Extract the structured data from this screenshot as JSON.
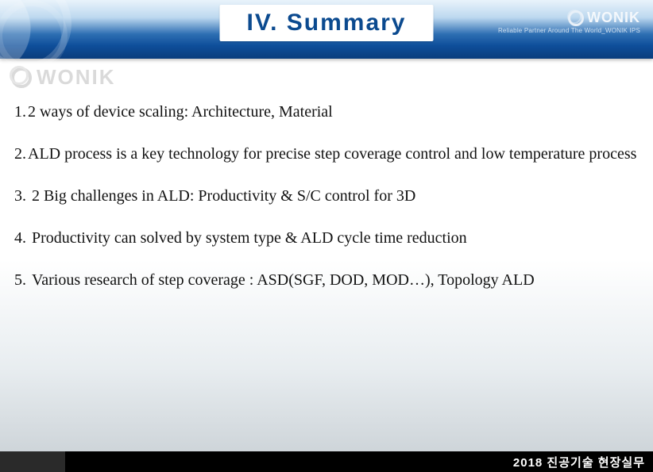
{
  "header": {
    "title": "IV.  Summary",
    "brand_name": "WONIK",
    "brand_tagline": "Reliable Partner Around The World_WONIK IPS"
  },
  "watermark": {
    "brand_name": "WONIK"
  },
  "summary": {
    "items": [
      {
        "num": "1.",
        "text": "2 ways of device scaling: Architecture, Material",
        "pad": ""
      },
      {
        "num": "2.",
        "text": "ALD process is a key technology for precise step coverage control and low temperature process",
        "pad": ""
      },
      {
        "num": "3.",
        "text": "2 Big challenges in ALD: Productivity & S/C control for 3D",
        "pad": " "
      },
      {
        "num": "4.",
        "text": "Productivity can solved by system type & ALD cycle time reduction",
        "pad": " "
      },
      {
        "num": "5.",
        "text": "Various research of step coverage : ASD(SGF, DOD, MOD…), Topology ALD",
        "pad": " "
      }
    ]
  },
  "footer": {
    "text": "2018 진공기술 현장실무"
  }
}
